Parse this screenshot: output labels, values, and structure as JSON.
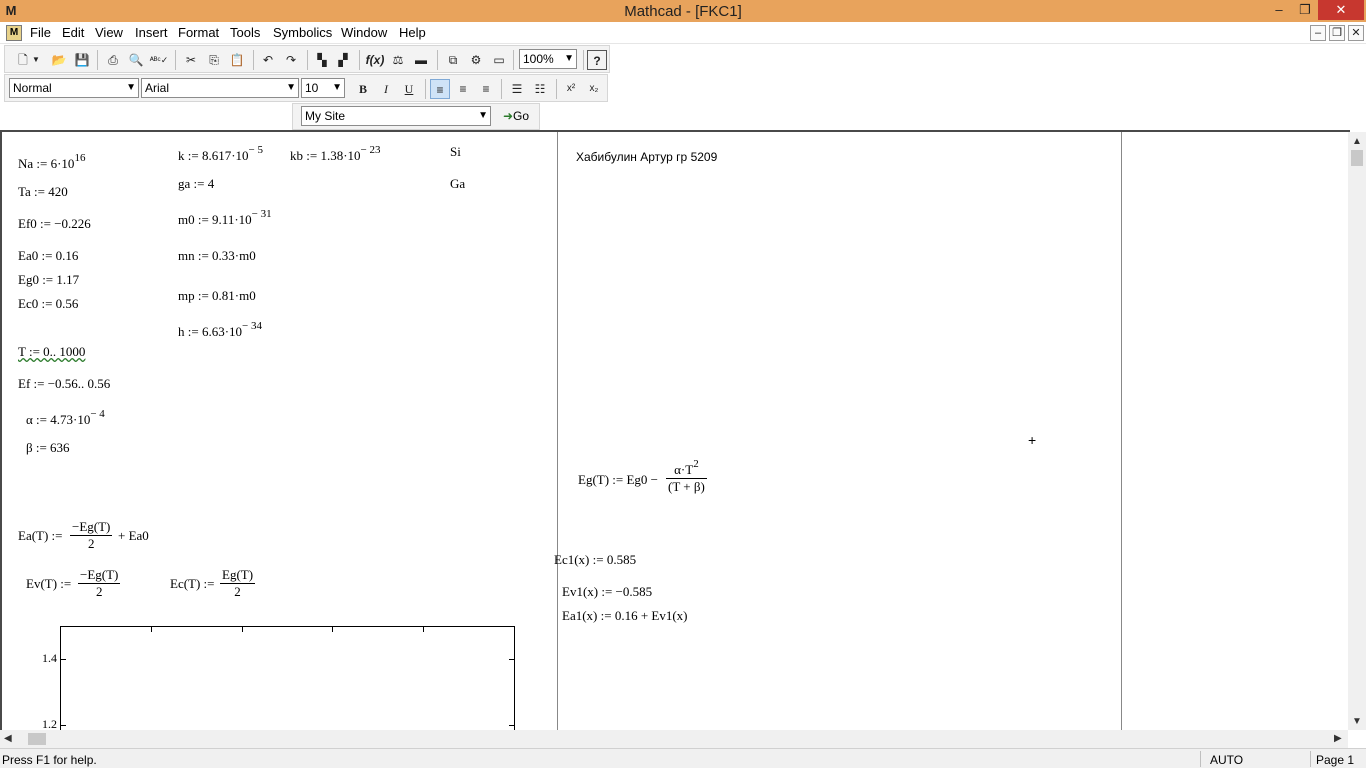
{
  "window": {
    "title": "Mathcad - [FKC1]",
    "app_icon": "M",
    "controls": {
      "minimize": "–",
      "restore": "❐",
      "close": "✕"
    }
  },
  "menu": {
    "items": [
      "File",
      "Edit",
      "View",
      "Insert",
      "Format",
      "Tools",
      "Symbolics",
      "Window",
      "Help"
    ],
    "doc_controls": {
      "minimize": "–",
      "restore": "❐",
      "close": "✕"
    }
  },
  "toolbar": {
    "zoom": "100%",
    "help_icon": "?"
  },
  "format_toolbar": {
    "style": "Normal",
    "font": "Arial",
    "size": "10",
    "bold": "B",
    "italic": "I",
    "underline": "U",
    "superscript": "x²",
    "subscript": "x₂"
  },
  "web_toolbar": {
    "site": "My Site",
    "go": "Go"
  },
  "worksheet": {
    "left": {
      "na": "Na := 6·10",
      "na_exp": "16",
      "ta": "Ta := 420",
      "ef0": "Ef0 := −0.226",
      "ea0": "Ea0 := 0.16",
      "eg0": "Eg0 := 1.17",
      "ec0": "Ec0 := 0.56",
      "t_range": "T := 0.. 1000",
      "ef_range": "Ef := −0.56.. 0.56",
      "alpha": "α := 4.73·10",
      "alpha_exp": "− 4",
      "beta": "β := 636",
      "k": "k := 8.617·10",
      "k_exp": "− 5",
      "kb": "kb := 1.38·10",
      "kb_exp": "− 23",
      "ga": "ga := 4",
      "m0": "m0 := 9.11·10",
      "m0_exp": "− 31",
      "mn": "mn := 0.33·m0",
      "mp": "mp := 0.81·m0",
      "h": "h := 6.63·10",
      "h_exp": "− 34",
      "si": "Si",
      "ga_label": "Ga",
      "ea_lhs": "Ea(T) :=",
      "ea_num": "−Eg(T)",
      "ea_den": "2",
      "ea_tail": "+ Ea0",
      "ev_lhs": "Ev(T) :=",
      "ev_num": "−Eg(T)",
      "ev_den": "2",
      "ec_lhs": "Ec(T) :=",
      "ec_num": "Eg(T)",
      "ec_den": "2"
    },
    "right": {
      "author": "Хабибулин Артур гр 5209",
      "eg_lhs": "Eg(T) := Eg0 −",
      "eg_num": "α·T",
      "eg_num_exp": "2",
      "eg_den": "(T + β)",
      "ec1": "Ec1(x) := 0.585",
      "ev1": "Ev1(x) := −0.585",
      "ea1": "Ea1(x) := 0.16 + Ev1(x)"
    },
    "plot": {
      "y_ticks": [
        "1.4",
        "1.2"
      ]
    },
    "cursor": "+"
  },
  "status": {
    "help": "Press F1 for help.",
    "mode": "AUTO",
    "page": "Page 1"
  }
}
